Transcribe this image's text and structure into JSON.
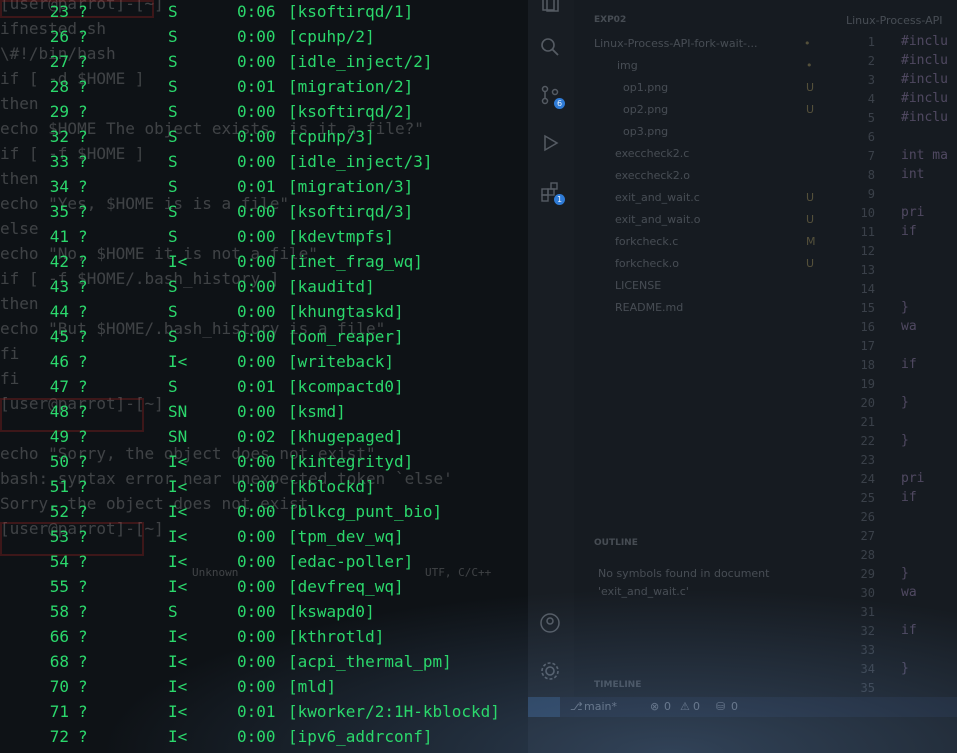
{
  "background_editor": {
    "explorer_header": "EXP02",
    "folder": "Linux-Process-API-fork-wait-...",
    "folder_mark": "•",
    "files": [
      {
        "name": "img",
        "mark": "•"
      },
      {
        "name": "op1.png",
        "mark": "U"
      },
      {
        "name": "op2.png",
        "mark": "U"
      },
      {
        "name": "op3.png",
        "mark": ""
      },
      {
        "name": "execcheck2.c",
        "mark": ""
      },
      {
        "name": "execcheck2.o",
        "mark": ""
      },
      {
        "name": "exit_and_wait.c",
        "mark": "U"
      },
      {
        "name": "exit_and_wait.o",
        "mark": "U"
      },
      {
        "name": "forkcheck.c",
        "mark": "M"
      },
      {
        "name": "forkcheck.o",
        "mark": "U"
      },
      {
        "name": "LICENSE",
        "mark": ""
      },
      {
        "name": "README.md",
        "mark": ""
      }
    ],
    "editor_tab": "Linux-Process-API",
    "outline_header": "OUTLINE",
    "outline_message_1": "No symbols found in document",
    "outline_message_2": "'exit_and_wait.c'",
    "timeline_header": "TIMELINE",
    "line_numbers": [
      "1",
      "2",
      "3",
      "4",
      "5",
      "6",
      "7",
      "8",
      "9",
      "10",
      "11",
      "12",
      "13",
      "14",
      "15",
      "16",
      "17",
      "18",
      "19",
      "20",
      "21",
      "22",
      "23",
      "24",
      "25",
      "26",
      "27",
      "28",
      "29",
      "30",
      "31",
      "32",
      "33",
      "34",
      "35"
    ],
    "code_lines": [
      "#inclu",
      "#inclu",
      "#inclu",
      "#inclu",
      "#inclu",
      "",
      "int ma",
      "  int",
      "",
      "  pri",
      "  if",
      "",
      "",
      "",
      "  }",
      "  wa",
      "",
      "  if",
      "",
      "  }",
      "",
      "  }",
      "",
      "  pri",
      "  if",
      "",
      "",
      "",
      "  }",
      "  wa",
      "",
      "  if",
      "",
      "  }",
      ""
    ],
    "status": {
      "branch": "main*",
      "errors": "0",
      "warnings": "0",
      "ports": "0"
    },
    "badges": {
      "scm": "6",
      "extensions": "1"
    }
  },
  "background_shell": {
    "lines": [
      "[user@parrot]-[~]",
      "   ifnested.sh",
      "\\#!/bin/bash",
      "if [ -d $HOME ]",
      "then",
      "echo $HOME The object exists, is it a file?\"",
      "if [ -f $HOME ]",
      "then",
      "echo \"Yes, $HOME is is a file\"",
      "else",
      "echo \"No, $HOME it is not a file\"",
      "if [ -f $HOME/.bash_history ]",
      "then",
      "echo \"But $HOME/.bash_history is a file\"",
      "fi",
      "fi",
      "  [user@parrot]-[~]",
      "",
      "echo \"Sorry, the object does not exist\"",
      "bash: syntax error near unexpected token `else'",
      "Sorry, the object does not exist",
      "  [user@parrot]-[~]"
    ],
    "status_fragments": [
      "Unknown",
      "UTF, C/C++"
    ]
  },
  "ps_output": {
    "rows": [
      {
        "pid": "23",
        "tty": "?",
        "stat": "S",
        "time": "0:06",
        "cmd": "[ksoftirqd/1]"
      },
      {
        "pid": "26",
        "tty": "?",
        "stat": "S",
        "time": "0:00",
        "cmd": "[cpuhp/2]"
      },
      {
        "pid": "27",
        "tty": "?",
        "stat": "S",
        "time": "0:00",
        "cmd": "[idle_inject/2]"
      },
      {
        "pid": "28",
        "tty": "?",
        "stat": "S",
        "time": "0:01",
        "cmd": "[migration/2]"
      },
      {
        "pid": "29",
        "tty": "?",
        "stat": "S",
        "time": "0:00",
        "cmd": "[ksoftirqd/2]"
      },
      {
        "pid": "32",
        "tty": "?",
        "stat": "S",
        "time": "0:00",
        "cmd": "[cpuhp/3]"
      },
      {
        "pid": "33",
        "tty": "?",
        "stat": "S",
        "time": "0:00",
        "cmd": "[idle_inject/3]"
      },
      {
        "pid": "34",
        "tty": "?",
        "stat": "S",
        "time": "0:01",
        "cmd": "[migration/3]"
      },
      {
        "pid": "35",
        "tty": "?",
        "stat": "S",
        "time": "0:00",
        "cmd": "[ksoftirqd/3]"
      },
      {
        "pid": "41",
        "tty": "?",
        "stat": "S",
        "time": "0:00",
        "cmd": "[kdevtmpfs]"
      },
      {
        "pid": "42",
        "tty": "?",
        "stat": "I<",
        "time": "0:00",
        "cmd": "[inet_frag_wq]"
      },
      {
        "pid": "43",
        "tty": "?",
        "stat": "S",
        "time": "0:00",
        "cmd": "[kauditd]"
      },
      {
        "pid": "44",
        "tty": "?",
        "stat": "S",
        "time": "0:00",
        "cmd": "[khungtaskd]"
      },
      {
        "pid": "45",
        "tty": "?",
        "stat": "S",
        "time": "0:00",
        "cmd": "[oom_reaper]"
      },
      {
        "pid": "46",
        "tty": "?",
        "stat": "I<",
        "time": "0:00",
        "cmd": "[writeback]"
      },
      {
        "pid": "47",
        "tty": "?",
        "stat": "S",
        "time": "0:01",
        "cmd": "[kcompactd0]"
      },
      {
        "pid": "48",
        "tty": "?",
        "stat": "SN",
        "time": "0:00",
        "cmd": "[ksmd]"
      },
      {
        "pid": "49",
        "tty": "?",
        "stat": "SN",
        "time": "0:02",
        "cmd": "[khugepaged]"
      },
      {
        "pid": "50",
        "tty": "?",
        "stat": "I<",
        "time": "0:00",
        "cmd": "[kintegrityd]"
      },
      {
        "pid": "51",
        "tty": "?",
        "stat": "I<",
        "time": "0:00",
        "cmd": "[kblockd]"
      },
      {
        "pid": "52",
        "tty": "?",
        "stat": "I<",
        "time": "0:00",
        "cmd": "[blkcg_punt_bio]"
      },
      {
        "pid": "53",
        "tty": "?",
        "stat": "I<",
        "time": "0:00",
        "cmd": "[tpm_dev_wq]"
      },
      {
        "pid": "54",
        "tty": "?",
        "stat": "I<",
        "time": "0:00",
        "cmd": "[edac-poller]"
      },
      {
        "pid": "55",
        "tty": "?",
        "stat": "I<",
        "time": "0:00",
        "cmd": "[devfreq_wq]"
      },
      {
        "pid": "58",
        "tty": "?",
        "stat": "S",
        "time": "0:00",
        "cmd": "[kswapd0]"
      },
      {
        "pid": "66",
        "tty": "?",
        "stat": "I<",
        "time": "0:00",
        "cmd": "[kthrotld]"
      },
      {
        "pid": "68",
        "tty": "?",
        "stat": "I<",
        "time": "0:00",
        "cmd": "[acpi_thermal_pm]"
      },
      {
        "pid": "70",
        "tty": "?",
        "stat": "I<",
        "time": "0:00",
        "cmd": "[mld]"
      },
      {
        "pid": "71",
        "tty": "?",
        "stat": "I<",
        "time": "0:01",
        "cmd": "[kworker/2:1H-kblockd]"
      },
      {
        "pid": "72",
        "tty": "?",
        "stat": "I<",
        "time": "0:00",
        "cmd": "[ipv6_addrconf]"
      }
    ]
  },
  "colors": {
    "terminal_text": "#2bd86c",
    "terminal_bg": "#0e1216",
    "editor_bg": "#161b21"
  }
}
